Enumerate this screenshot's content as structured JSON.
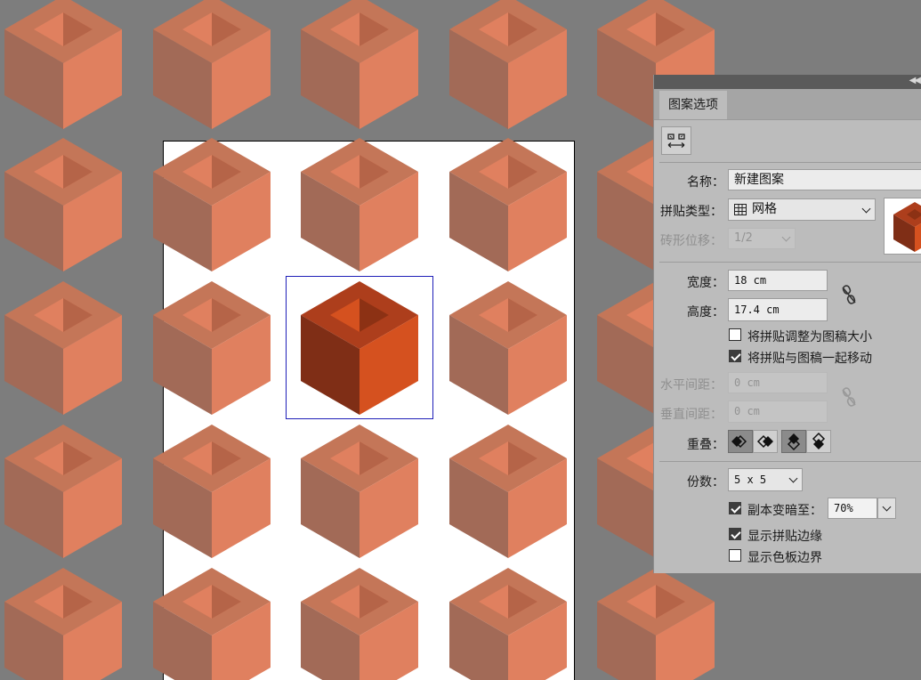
{
  "panel": {
    "tab_label": "图案选项",
    "name_label": "名称：",
    "name_value": "新建图案",
    "tile_type_label": "拼贴类型：",
    "tile_type_value": "网格",
    "brick_offset_label": "砖形位移：",
    "brick_offset_value": "1/2",
    "width_label": "宽度：",
    "width_value": "18 cm",
    "height_label": "高度：",
    "height_value": "17.4 cm",
    "resize_tile_label": "将拼贴调整为图稿大小",
    "resize_tile_checked": false,
    "move_tile_label": "将拼贴与图稿一起移动",
    "move_tile_checked": true,
    "h_spacing_label": "水平间距：",
    "h_spacing_value": "0 cm",
    "v_spacing_label": "垂直间距：",
    "v_spacing_value": "0 cm",
    "overlap_label": "重叠：",
    "copies_label": "份数：",
    "copies_value": "5 x 5",
    "dim_copies_label": "副本变暗至：",
    "dim_copies_checked": true,
    "dim_copies_value": "70%",
    "show_tile_edge_label": "显示拼贴边缘",
    "show_tile_edge_checked": true,
    "show_swatch_bounds_label": "显示色板边界",
    "show_swatch_bounds_checked": false
  },
  "colors": {
    "canvas_bg": "#7d7d7d",
    "cube_light_top": "#c47658",
    "cube_light_left": "#a26a57",
    "cube_light_right": "#e0805f",
    "cube_hole_light": "#e0805f",
    "cube_hole_dark": "#b56448",
    "main_top": "#ad3e1c",
    "main_left": "#7f2e16",
    "main_right": "#d5511f",
    "main_hole_light": "#d5511f",
    "main_hole_dark": "#8c3114"
  }
}
